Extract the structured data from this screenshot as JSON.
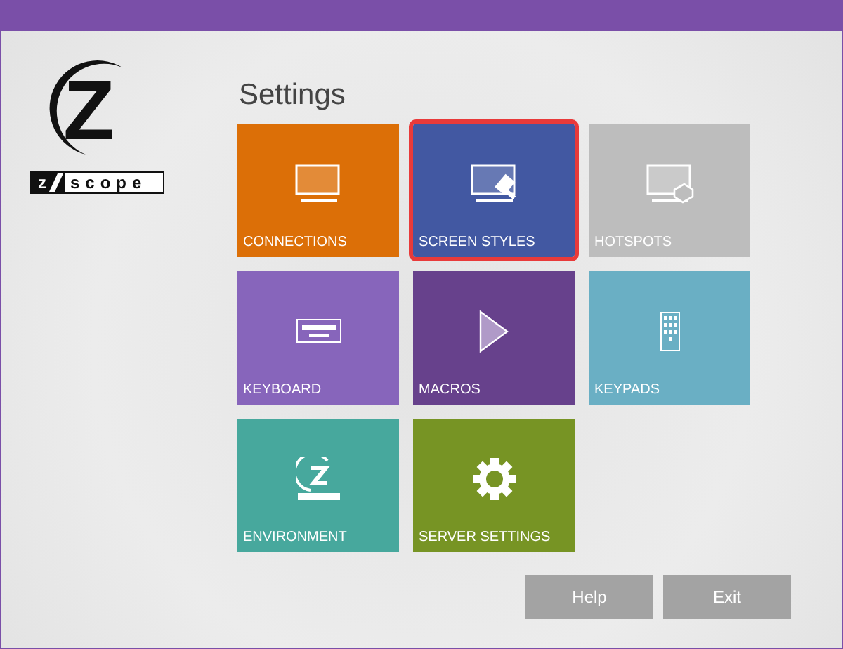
{
  "logo": {
    "letter": "Z",
    "badge_left": "z",
    "badge_right": "scope"
  },
  "title": "Settings",
  "tiles": [
    {
      "label": "CONNECTIONS",
      "kind": "monitor",
      "color": "#dc6f07",
      "selected": false
    },
    {
      "label": "SCREEN STYLES",
      "kind": "brush",
      "color": "#4258a2",
      "selected": true
    },
    {
      "label": "HOTSPOTS",
      "kind": "hotspot",
      "color": "#bdbdbd",
      "selected": false
    },
    {
      "label": "KEYBOARD",
      "kind": "keyboard",
      "color": "#8765bb",
      "selected": false
    },
    {
      "label": "MACROS",
      "kind": "play",
      "color": "#67418c",
      "selected": false
    },
    {
      "label": "KEYPADS",
      "kind": "keypad",
      "color": "#6aafc4",
      "selected": false
    },
    {
      "label": "ENVIRONMENT",
      "kind": "zlogo",
      "color": "#47a89d",
      "selected": false
    },
    {
      "label": "SERVER SETTINGS",
      "kind": "gear",
      "color": "#779424",
      "selected": false
    }
  ],
  "buttons": [
    "Help",
    "Exit"
  ]
}
